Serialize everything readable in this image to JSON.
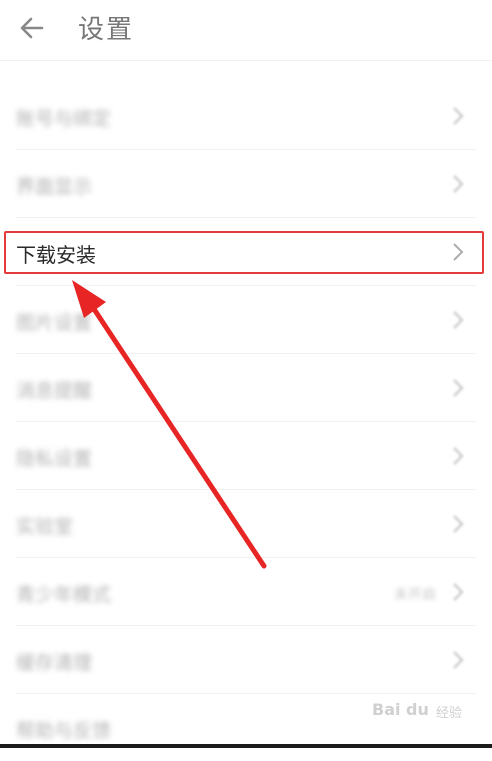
{
  "header": {
    "title": "设置"
  },
  "rows": [
    {
      "label": "账号与绑定",
      "value": ""
    },
    {
      "label": "界面显示",
      "value": ""
    },
    {
      "label": "下载安装",
      "value": ""
    },
    {
      "label": "图片设置",
      "value": ""
    },
    {
      "label": "消息提醒",
      "value": ""
    },
    {
      "label": "隐私设置",
      "value": ""
    },
    {
      "label": "实验室",
      "value": ""
    },
    {
      "label": "青少年模式",
      "value": "未开启"
    },
    {
      "label": "缓存清理",
      "value": ""
    },
    {
      "label": "帮助与反馈",
      "value": ""
    }
  ],
  "annotation": {
    "color": "#e63a3a"
  },
  "watermark": {
    "brand": "Bai du",
    "text": "经验"
  }
}
